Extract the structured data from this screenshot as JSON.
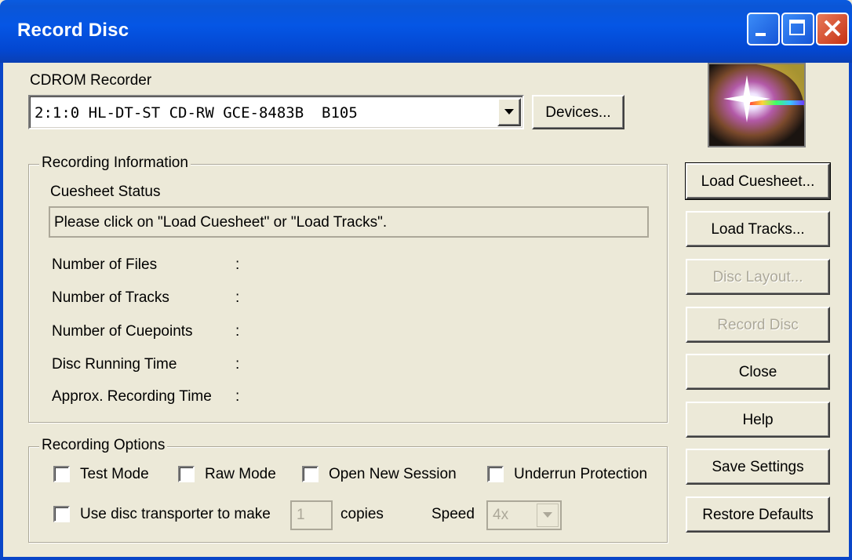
{
  "window": {
    "title": "Record Disc"
  },
  "recorder": {
    "label": "CDROM Recorder",
    "selected": "2:1:0 HL-DT-ST CD-RW GCE-8483B  B105",
    "devices_button": "Devices..."
  },
  "info": {
    "legend": "Recording Information",
    "cuesheet_status_label": "Cuesheet Status",
    "cuesheet_status": "Please click on \"Load Cuesheet\" or \"Load Tracks\".",
    "rows": [
      {
        "label": "Number of Files",
        "sep": ":"
      },
      {
        "label": "Number of Tracks",
        "sep": ":"
      },
      {
        "label": "Number of Cuepoints",
        "sep": ":"
      },
      {
        "label": "Disc Running Time",
        "sep": ":"
      },
      {
        "label": "Approx. Recording Time",
        "sep": ":"
      }
    ]
  },
  "options": {
    "legend": "Recording Options",
    "test_mode": "Test Mode",
    "raw_mode": "Raw Mode",
    "open_new_session": "Open New Session",
    "underrun_protection": "Underrun Protection",
    "use_transporter": "Use disc transporter to make",
    "copies_value": "1",
    "copies_label": "copies",
    "speed_label": "Speed",
    "speed_value": "4x"
  },
  "buttons": {
    "load_cuesheet": "Load Cuesheet...",
    "load_tracks": "Load Tracks...",
    "disc_layout": "Disc Layout...",
    "record_disc": "Record Disc",
    "close": "Close",
    "help": "Help",
    "save_settings": "Save Settings",
    "restore_defaults": "Restore Defaults"
  },
  "icons": {
    "logo": "disc-sparkle-icon",
    "dropdown": "chevron-down-icon"
  }
}
